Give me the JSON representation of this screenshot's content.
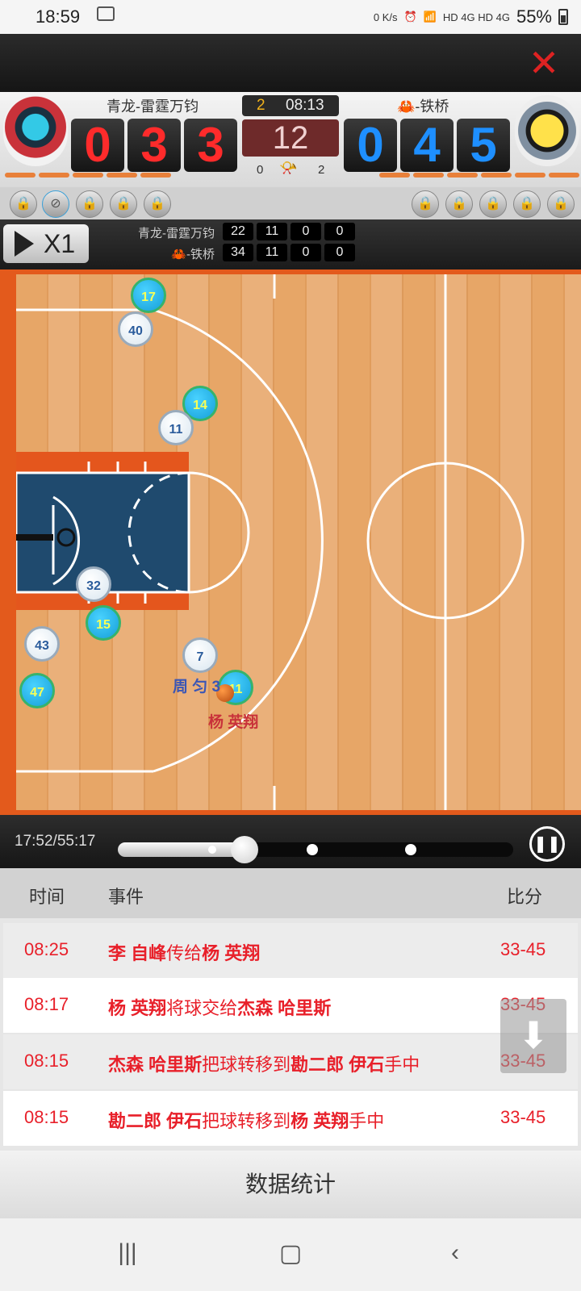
{
  "status_bar": {
    "time": "18:59",
    "net_speed": "0 K/s",
    "signal_labels": "HD 4G HD 4G",
    "battery": "55%"
  },
  "header": {
    "close_icon": "close-icon"
  },
  "scoreboard": {
    "home_name": "青龙-雷霆万钧",
    "away_name": "🦀-铁桥",
    "home_digits": [
      "0",
      "3",
      "3"
    ],
    "away_digits": [
      "0",
      "4",
      "5"
    ],
    "quarter": "2",
    "clock": "08:13",
    "shot_clock": "12",
    "home_fouls": "0",
    "away_fouls": "2",
    "home_color": "#ff2b2b",
    "away_color": "#1e8fff"
  },
  "controls": {
    "speed_label": "X1",
    "stat_rows": [
      {
        "team": "青龙-雷霆万钧",
        "values": [
          "22",
          "11",
          "0",
          "0"
        ]
      },
      {
        "team": "🦀-铁桥",
        "values": [
          "34",
          "11",
          "0",
          "0"
        ]
      }
    ]
  },
  "court": {
    "home_players": [
      "40",
      "11",
      "32",
      "43",
      "7"
    ],
    "away_players": [
      "17",
      "14",
      "15",
      "47",
      "11"
    ],
    "name_labels": [
      "周 匀 3",
      "杨 英翔"
    ]
  },
  "playback": {
    "time_display": "17:52/55:17",
    "progress_fraction": 0.32,
    "pause_icon": "pause-icon"
  },
  "events": {
    "headers": {
      "time": "时间",
      "event": "事件",
      "score": "比分"
    },
    "rows": [
      {
        "time": "08:25",
        "a": "李 自峰",
        "mid": "传给",
        "b": "杨 英翔",
        "tail": "",
        "score": "33-45"
      },
      {
        "time": "08:17",
        "a": "杨 英翔",
        "mid": "将球交给",
        "b": "杰森 哈里斯",
        "tail": "",
        "score": "33-45"
      },
      {
        "time": "08:15",
        "a": "杰森 哈里斯",
        "mid": "把球转移到",
        "b": "勘二郎 伊石",
        "tail": "手中",
        "score": "33-45"
      },
      {
        "time": "08:15",
        "a": "勘二郎 伊石",
        "mid": "把球转移到",
        "b": "杨 英翔",
        "tail": "手中",
        "score": "33-45"
      }
    ]
  },
  "stats_button": "数据统计"
}
